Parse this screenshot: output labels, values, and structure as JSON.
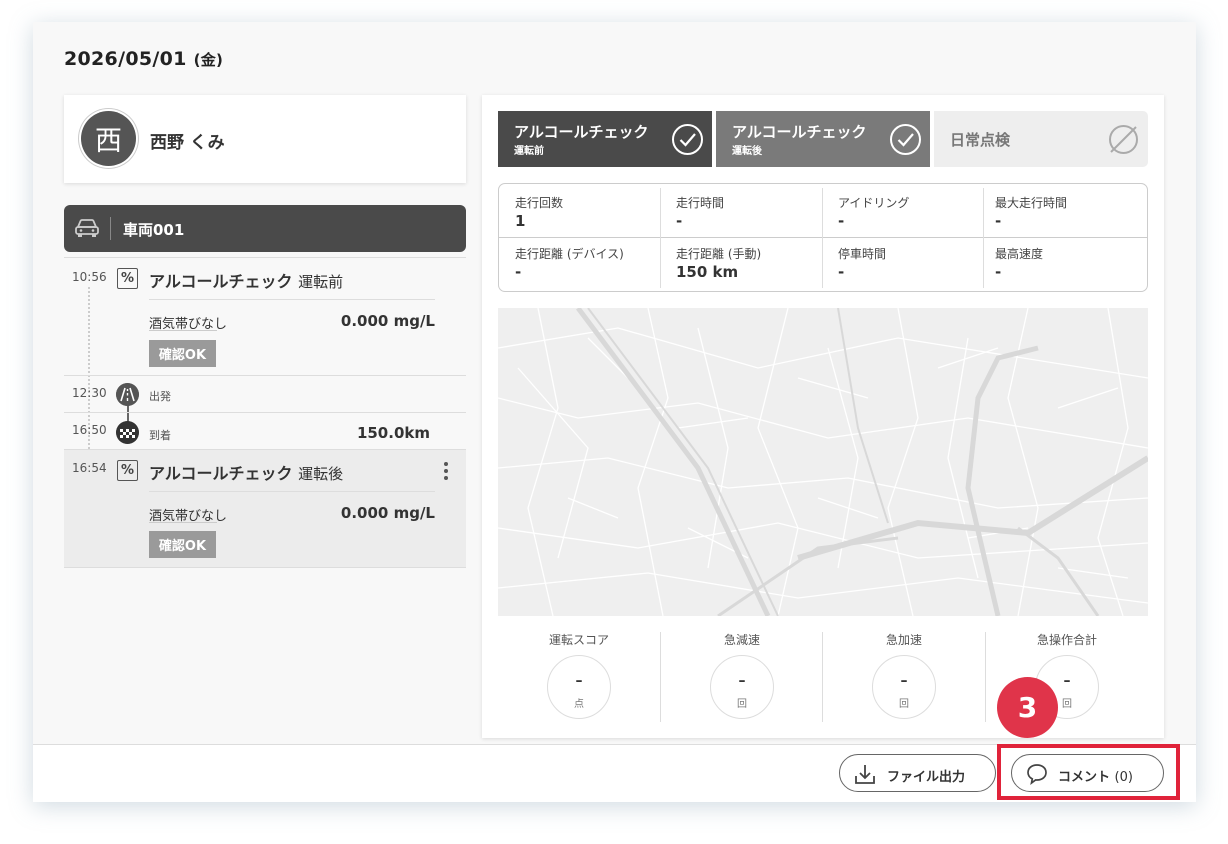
{
  "date": {
    "main": "2026/05/01",
    "dow": "(金)"
  },
  "driver": {
    "avatar_char": "西",
    "name": "西野 くみ"
  },
  "vehicle": {
    "name": "車両001",
    "icon": "car-icon"
  },
  "timeline": {
    "check_before": {
      "time": "10:56",
      "icon_text": "%",
      "title": "アルコールチェック",
      "subtitle": "運転前",
      "result_label": "酒気帯びなし",
      "result_value": "0.000 mg/L",
      "badge": "確認OK"
    },
    "depart": {
      "time": "12:30",
      "label": "出発",
      "icon": "road-icon"
    },
    "arrive": {
      "time": "16:50",
      "label": "到着",
      "value": "150.0km",
      "icon": "checkered-flag-icon"
    },
    "check_after": {
      "time": "16:54",
      "icon_text": "%",
      "title": "アルコールチェック",
      "subtitle": "運転後",
      "result_label": "酒気帯びなし",
      "result_value": "0.000 mg/L",
      "badge": "確認OK"
    }
  },
  "tabs": [
    {
      "title": "アルコールチェック",
      "sub": "運転前",
      "status": "checked",
      "color": "#4a4a4a"
    },
    {
      "title": "アルコールチェック",
      "sub": "運転後",
      "status": "checked",
      "color": "#7a7a7a"
    },
    {
      "title": "日常点検",
      "sub": "",
      "status": "none",
      "color": "#eeeeee"
    }
  ],
  "stats": {
    "drive_count": {
      "label": "走行回数",
      "value": "1"
    },
    "drive_time": {
      "label": "走行時間",
      "value": "-"
    },
    "idling": {
      "label": "アイドリング",
      "value": "-"
    },
    "max_drive_time": {
      "label": "最大走行時間",
      "value": "-"
    },
    "distance_device": {
      "label": "走行距離 (デバイス)",
      "value": "-"
    },
    "distance_manual": {
      "label": "走行距離 (手動)",
      "value": "150 km"
    },
    "stop_time": {
      "label": "停車時間",
      "value": "-"
    },
    "max_speed": {
      "label": "最高速度",
      "value": "-"
    }
  },
  "scores": [
    {
      "label": "運転スコア",
      "value": "–",
      "unit": "点"
    },
    {
      "label": "急減速",
      "value": "–",
      "unit": "回"
    },
    {
      "label": "急加速",
      "value": "–",
      "unit": "回"
    },
    {
      "label": "急操作合計",
      "value": "–",
      "unit": "回"
    }
  ],
  "buttons": {
    "export_label": "ファイル出力",
    "comment_label": "コメント",
    "comment_count": "(0)"
  },
  "step_badge": "3",
  "colors": {
    "highlight": "#e0233a",
    "badge": "#e0344a",
    "ok_badge": "#9a9a9a"
  }
}
